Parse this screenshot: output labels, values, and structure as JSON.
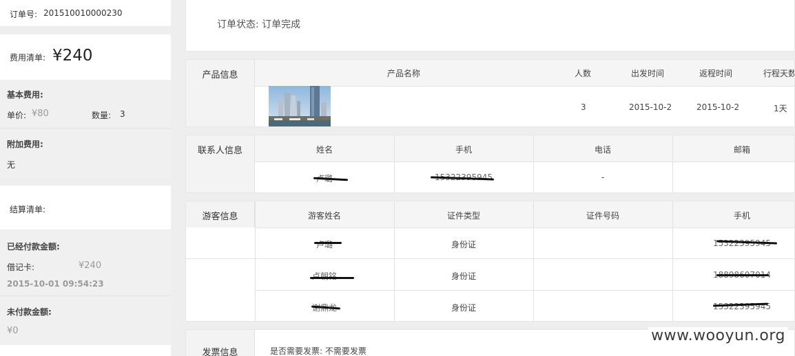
{
  "sidebar": {
    "order_no_label": "订单号:",
    "order_no": "201510010000230",
    "fee_label": "费用清单:",
    "fee_total": "¥240",
    "basic_fee_title": "基本费用:",
    "unit_price_label": "单价:",
    "unit_price": "¥80",
    "quantity_label": "数量:",
    "quantity": "3",
    "extra_fee_title": "附加费用:",
    "extra_fee_value": "无",
    "settlement_label": "结算清单:",
    "paid_title": "已经付款金额:",
    "debit_card_label": "借记卡:",
    "debit_card_amount": "¥240",
    "paid_time": "2015-10-01 09:54:23",
    "unpaid_title": "未付款金额:",
    "unpaid_amount": "¥0"
  },
  "order_status": "订单状态: 订单完成",
  "product": {
    "section_label": "产品信息",
    "headers": [
      "产品名称",
      "人数",
      "出发时间",
      "返程时间",
      "行程天数"
    ],
    "row": {
      "people": "3",
      "depart": "2015-10-2",
      "return": "2015-10-2",
      "days": "1天"
    }
  },
  "contact": {
    "section_label": "联系人信息",
    "headers": [
      "姓名",
      "手机",
      "电话",
      "邮箱"
    ],
    "row": {
      "name": "卢璐",
      "mobile": "15322395945",
      "phone": "-",
      "email": ""
    }
  },
  "tourists": {
    "section_label": "游客信息",
    "headers": [
      "游客姓名",
      "证件类型",
      "证件号码",
      "手机"
    ],
    "rows": [
      {
        "name": "卢璐",
        "id_type": "身份证",
        "id_no": "",
        "mobile": "15322395945"
      },
      {
        "name": "卢朝铭",
        "id_type": "身份证",
        "id_no": "",
        "mobile": "18898607014"
      },
      {
        "name": "谢鼎龙",
        "id_type": "身份证",
        "id_no": "",
        "mobile": "15322395945"
      }
    ]
  },
  "invoice": {
    "section_label": "发票信息",
    "text": "是否需要发票: 不需要发票"
  },
  "watermark": "www.wooyun.org",
  "colors": {
    "background": "#eeeeee",
    "panel": "#ffffff",
    "section_label_bg": "#f3f3f3",
    "muted": "#9a9a9a"
  }
}
